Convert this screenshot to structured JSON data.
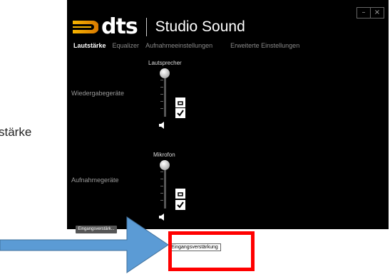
{
  "document": {
    "partial_text": "stärke"
  },
  "window": {
    "controls": {
      "minimize": "–",
      "close": "×"
    },
    "brand": {
      "mark": "dts",
      "product": "Studio Sound"
    },
    "tabs": [
      {
        "label": "Lautstärke",
        "active": true
      },
      {
        "label": "Equalizer"
      },
      {
        "label": "Aufnahmeeinstellungen"
      },
      {
        "label": "Erweiterte Einstellungen"
      }
    ],
    "playback": {
      "row_label": "Wiedergabegeräte",
      "device": "Lautsprecher",
      "volume_level": 1.0
    },
    "recording": {
      "row_label": "Aufnahmegeräte",
      "device": "Mikrofon",
      "volume_level": 1.0,
      "gain_button": "Eingangsverstärk..."
    },
    "tooltip": "Eingangsverstärkung"
  },
  "colors": {
    "window_bg": "#000000",
    "highlight": "#ff0000",
    "arrow": "#5b9bd5"
  },
  "icons": [
    "dts-logo-icon",
    "speaker-icon",
    "checkbox-icon",
    "arrow-icon"
  ]
}
